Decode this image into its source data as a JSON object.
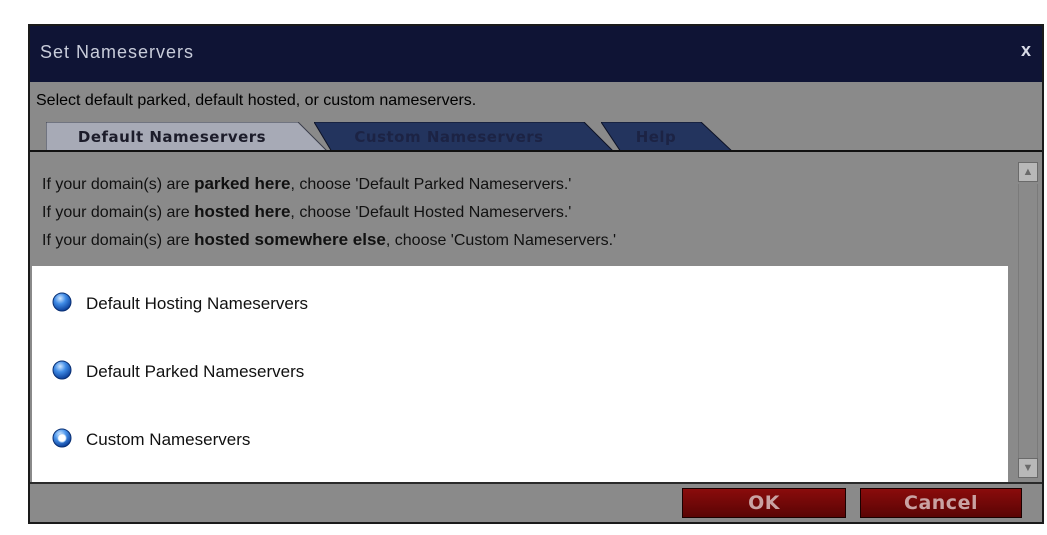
{
  "dialog": {
    "title": "Set Nameservers",
    "close_label": "x",
    "instruction": "Select default parked, default hosted, or custom nameservers."
  },
  "tabs": [
    {
      "label": "Default Nameservers",
      "active": true
    },
    {
      "label": "Custom Nameservers",
      "active": false
    },
    {
      "label": "Help",
      "active": false
    }
  ],
  "info": {
    "line1_prefix": "If your domain(s) are ",
    "line1_bold": "parked here",
    "line1_suffix": ", choose 'Default Parked Nameservers.'",
    "line2_prefix": "If your domain(s) are ",
    "line2_bold": "hosted here",
    "line2_suffix": ", choose 'Default Hosted Nameservers.'",
    "line3_prefix": "If your domain(s) are ",
    "line3_bold": "hosted somewhere else",
    "line3_suffix": ", choose 'Custom Nameservers.'"
  },
  "options": [
    {
      "label": "Default Hosting Nameservers",
      "selected": false
    },
    {
      "label": "Default Parked Nameservers",
      "selected": false
    },
    {
      "label": "Custom Nameservers",
      "selected": true
    }
  ],
  "buttons": {
    "ok": "OK",
    "cancel": "Cancel"
  },
  "colors": {
    "titlebar": "#0f1435",
    "active_tab": "#a7aab6",
    "inactive_tab": "#23345e",
    "dialog_bg": "#8a8a8a",
    "button": "#7a0808"
  }
}
